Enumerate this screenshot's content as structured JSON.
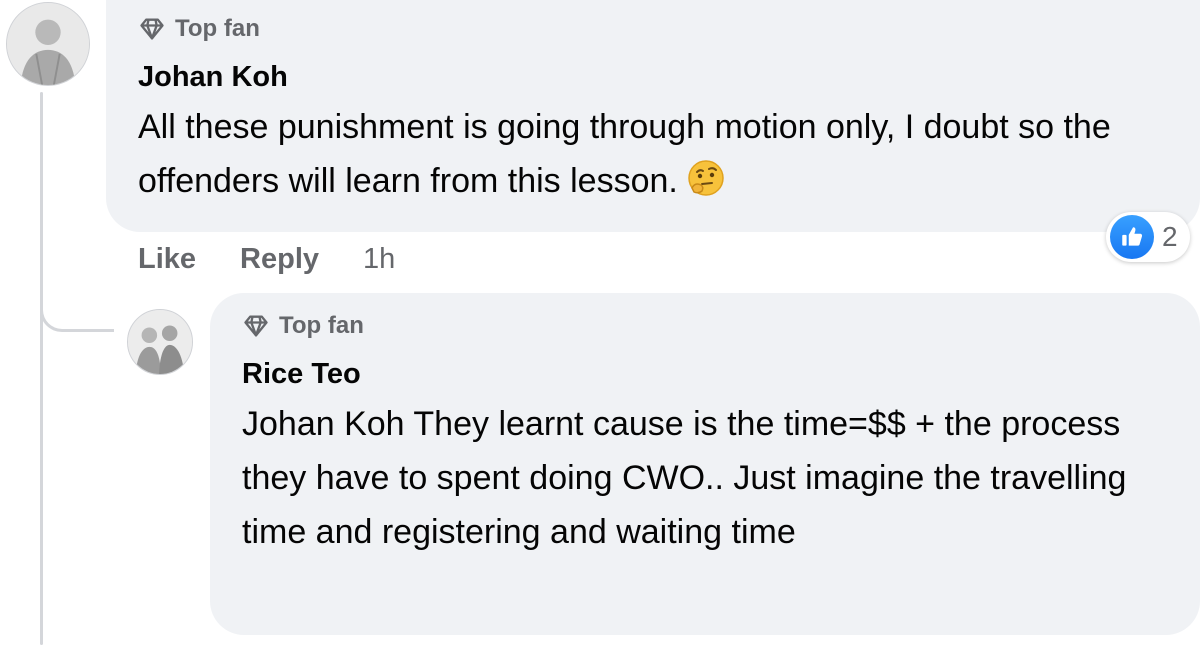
{
  "comments": [
    {
      "badge": "Top fan",
      "author": "Johan Koh",
      "text": "All these punishment is going through motion only, I doubt so the offenders will learn from this lesson.",
      "emoji": "thinking-face-icon",
      "reaction": {
        "icon": "like-icon",
        "count": "2",
        "color": "#1877f2"
      },
      "actions": {
        "like": "Like",
        "reply": "Reply",
        "time": "1h"
      }
    },
    {
      "badge": "Top fan",
      "author": "Rice Teo",
      "text": "Johan Koh They learnt cause is the time=$$ + the process they have to spent doing CWO.. Just imagine the travelling time and registering and waiting time"
    }
  ],
  "colors": {
    "bubble": "#f0f2f5",
    "secondary_text": "#65676b",
    "primary_text": "#050505",
    "thread_line": "#d4d6da"
  }
}
